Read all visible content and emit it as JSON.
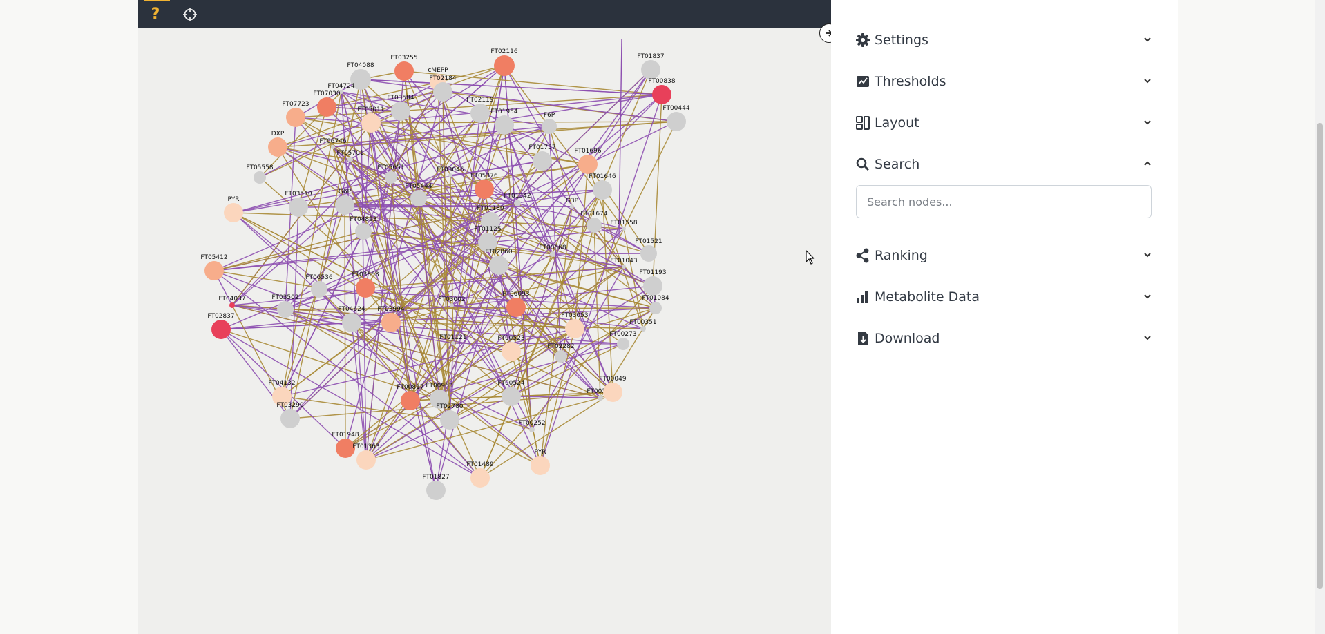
{
  "toolbar": {
    "help_label": "?",
    "help_color": "#f0b232",
    "target_icon": "crosshair-icon"
  },
  "panel": {
    "collapse_icon": "arrow-right-icon",
    "sections": [
      {
        "label": "Settings",
        "icon": "gear-icon",
        "expanded": false
      },
      {
        "label": "Thresholds",
        "icon": "chart-area-icon",
        "expanded": false
      },
      {
        "label": "Layout",
        "icon": "layout-icon",
        "expanded": false
      },
      {
        "label": "Search",
        "icon": "search-icon",
        "expanded": true
      },
      {
        "label": "Ranking",
        "icon": "share-nodes-icon",
        "expanded": false
      },
      {
        "label": "Metabolite Data",
        "icon": "bar-chart-icon",
        "expanded": false
      },
      {
        "label": "Download",
        "icon": "file-download-icon",
        "expanded": false
      }
    ],
    "search": {
      "placeholder": "Search nodes..."
    }
  },
  "colors": {
    "edge_gold": "#a88a36",
    "edge_purple": "#8d4fb0",
    "node_grey": "#cfcfcf",
    "node_pale": "#fbd6bd",
    "node_light": "#f7ad8b",
    "node_orange": "#f07e63",
    "node_red": "#e8405a"
  },
  "graph": {
    "nodes": [
      {
        "id": "FT02116",
        "c": "orange"
      },
      {
        "id": "FT03255",
        "c": "orange"
      },
      {
        "id": "FT04088",
        "c": "grey"
      },
      {
        "id": "cMEPP",
        "c": "pale"
      },
      {
        "id": "FT02184",
        "c": "grey"
      },
      {
        "id": "FT04724",
        "c": "grey"
      },
      {
        "id": "FT07030",
        "c": "orange"
      },
      {
        "id": "FT03584",
        "c": "grey"
      },
      {
        "id": "FT05011",
        "c": "pale"
      },
      {
        "id": "FT07723",
        "c": "light"
      },
      {
        "id": "FT02119",
        "c": "grey"
      },
      {
        "id": "FT01954",
        "c": "grey"
      },
      {
        "id": "F6P",
        "c": "grey"
      },
      {
        "id": "FT01837",
        "c": "grey"
      },
      {
        "id": "FT00838",
        "c": "red"
      },
      {
        "id": "FT00444",
        "c": "grey"
      },
      {
        "id": "DXP",
        "c": "light"
      },
      {
        "id": "FT06746",
        "c": "grey"
      },
      {
        "id": "FT05701",
        "c": "grey"
      },
      {
        "id": "FT05558",
        "c": "grey"
      },
      {
        "id": "FT05651",
        "c": "grey"
      },
      {
        "id": "FT03046",
        "c": "grey"
      },
      {
        "id": "FT05376",
        "c": "orange"
      },
      {
        "id": "FT01757",
        "c": "grey"
      },
      {
        "id": "FT01696",
        "c": "light"
      },
      {
        "id": "FT01646",
        "c": "grey"
      },
      {
        "id": "PYR",
        "c": "pale"
      },
      {
        "id": "FT03510",
        "c": "grey"
      },
      {
        "id": "G6P",
        "c": "grey"
      },
      {
        "id": "FT05444",
        "c": "grey"
      },
      {
        "id": "FT01342",
        "c": "grey"
      },
      {
        "id": "FT01180",
        "c": "grey"
      },
      {
        "id": "G3P",
        "c": "grey"
      },
      {
        "id": "FT01125",
        "c": "grey"
      },
      {
        "id": "FT01674",
        "c": "grey"
      },
      {
        "id": "FT01558",
        "c": "grey"
      },
      {
        "id": "FT04893",
        "c": "grey"
      },
      {
        "id": "FT05412",
        "c": "light"
      },
      {
        "id": "FT01521",
        "c": "grey"
      },
      {
        "id": "FT02860",
        "c": "grey"
      },
      {
        "id": "FT08668",
        "c": "grey"
      },
      {
        "id": "FT01043",
        "c": "grey"
      },
      {
        "id": "FT06536",
        "c": "grey"
      },
      {
        "id": "FT03868",
        "c": "orange"
      },
      {
        "id": "FT01193",
        "c": "grey"
      },
      {
        "id": "FT04037",
        "c": "red"
      },
      {
        "id": "FT03502",
        "c": "grey"
      },
      {
        "id": "FT03002",
        "c": "grey"
      },
      {
        "id": "FT06093",
        "c": "orange"
      },
      {
        "id": "FT01084",
        "c": "grey"
      },
      {
        "id": "FT02837",
        "c": "red"
      },
      {
        "id": "FT04624",
        "c": "grey"
      },
      {
        "id": "FT03994",
        "c": "light"
      },
      {
        "id": "FT03053",
        "c": "pale"
      },
      {
        "id": "FT00351",
        "c": "grey"
      },
      {
        "id": "FT01121",
        "c": "grey"
      },
      {
        "id": "FT00523",
        "c": "pale"
      },
      {
        "id": "FT00273",
        "c": "grey"
      },
      {
        "id": "FT02282",
        "c": "grey"
      },
      {
        "id": "FT00347",
        "c": "grey"
      },
      {
        "id": "FT04132",
        "c": "pale"
      },
      {
        "id": "FT00817",
        "c": "orange"
      },
      {
        "id": "FT00963",
        "c": "grey"
      },
      {
        "id": "FT00524",
        "c": "grey"
      },
      {
        "id": "FT00049",
        "c": "pale"
      },
      {
        "id": "FT03290",
        "c": "grey"
      },
      {
        "id": "FT02780",
        "c": "grey"
      },
      {
        "id": "FT00252",
        "c": "grey"
      },
      {
        "id": "FT01948",
        "c": "orange"
      },
      {
        "id": "FT01363",
        "c": "pale"
      },
      {
        "id": "FT01489",
        "c": "pale"
      },
      {
        "id": "PYR",
        "c": "pale"
      },
      {
        "id": "FT01827",
        "c": "grey"
      }
    ]
  }
}
